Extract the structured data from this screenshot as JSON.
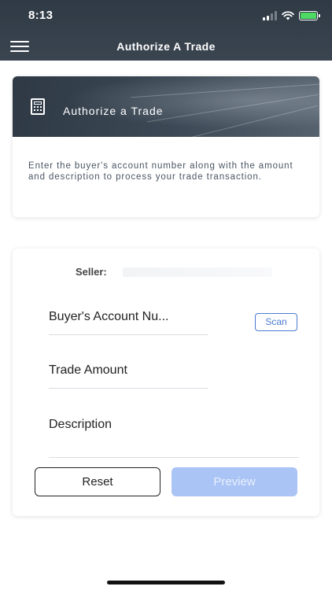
{
  "status_bar": {
    "time": "8:13"
  },
  "header": {
    "title": "Authorize A Trade"
  },
  "info_card": {
    "banner_title": "Authorize a Trade",
    "description": "Enter the buyer's account number along with the amount and description to process your trade transaction."
  },
  "form": {
    "seller_label": "Seller:",
    "account_placeholder": "Buyer's Account Nu...",
    "scan_label": "Scan",
    "amount_placeholder": "Trade Amount",
    "description_placeholder": "Description",
    "reset_label": "Reset",
    "preview_label": "Preview"
  },
  "colors": {
    "header_bg": "#2f3a45",
    "accent": "#4a7bd0",
    "preview_disabled": "#aac4f5",
    "battery": "#4cd964"
  },
  "icons": [
    "menu-icon",
    "calculator-icon",
    "wifi-icon",
    "signal-icon",
    "battery-icon"
  ]
}
